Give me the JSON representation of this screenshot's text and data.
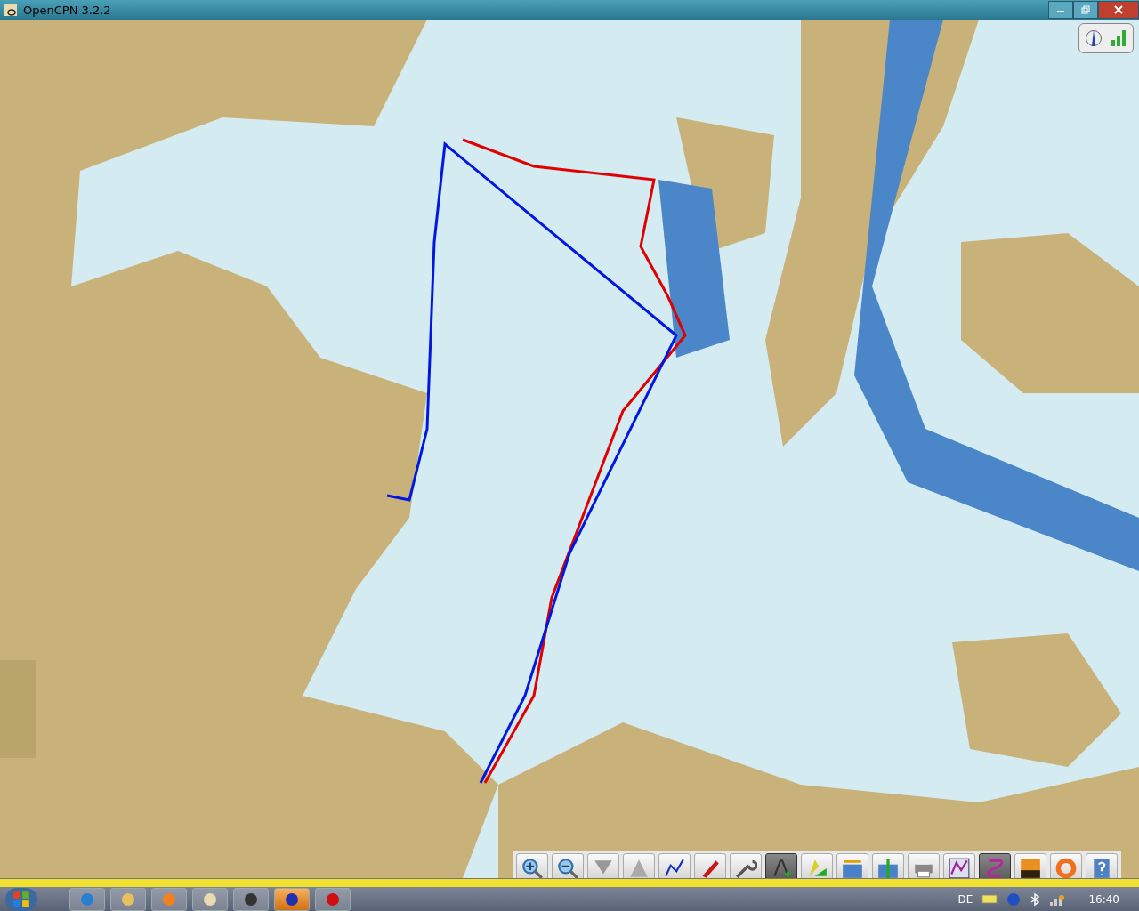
{
  "window": {
    "title": "OpenCPN 3.2.2"
  },
  "toolbar": [
    {
      "selected": false
    },
    {
      "selected": false
    },
    {
      "selected": false
    },
    {
      "selected": false
    },
    {
      "selected": false
    },
    {
      "selected": false
    },
    {
      "selected": false
    },
    {
      "selected": true
    },
    {
      "selected": false
    },
    {
      "selected": false
    },
    {
      "selected": false
    },
    {
      "selected": false
    },
    {
      "selected": false
    },
    {
      "selected": true
    },
    {
      "selected": false
    },
    {
      "selected": false
    },
    {
      "selected": false
    }
  ],
  "taskbar": {
    "apps": [
      {
        "selected": false
      },
      {
        "selected": false
      },
      {
        "selected": false
      },
      {
        "selected": false
      },
      {
        "selected": false
      },
      {
        "selected": true
      },
      {
        "selected": false
      }
    ],
    "language": "DE",
    "clock": "16:40"
  }
}
